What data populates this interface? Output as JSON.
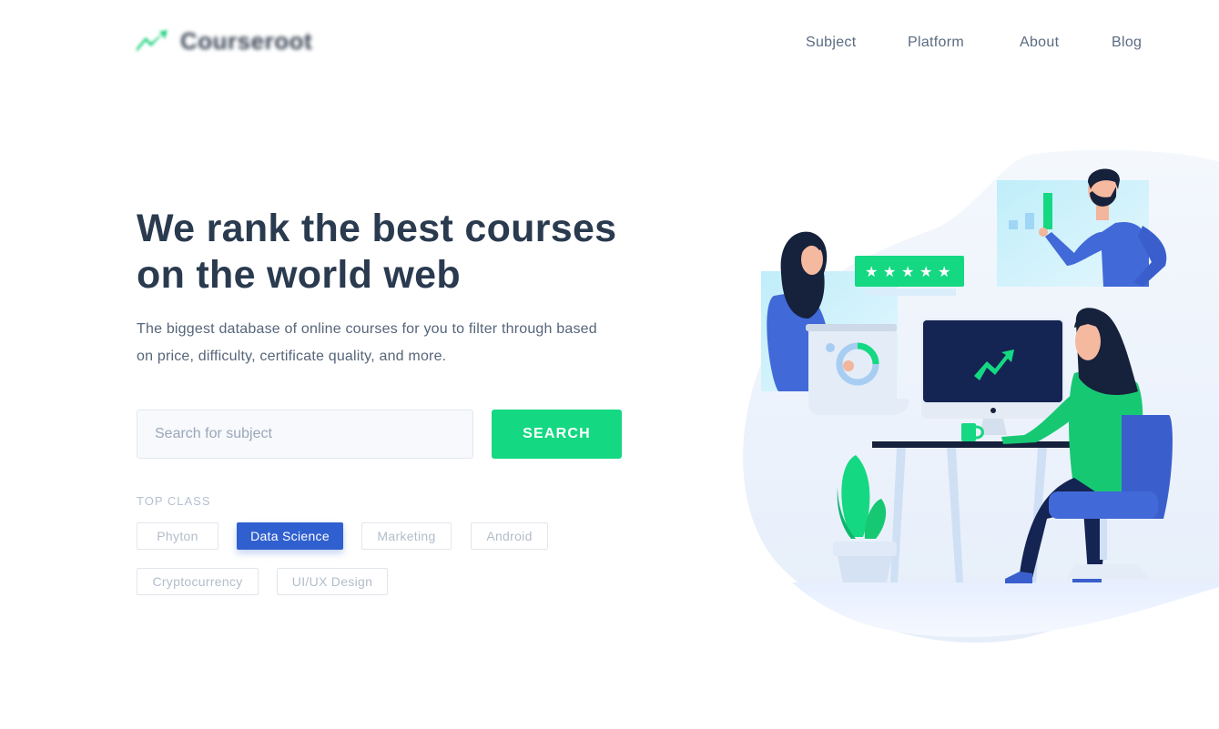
{
  "brand": {
    "name": "Courseroot",
    "accent": "#15d882"
  },
  "nav": {
    "items": [
      {
        "label": "Subject"
      },
      {
        "label": "Platform"
      },
      {
        "label": "About"
      },
      {
        "label": "Blog"
      }
    ]
  },
  "hero": {
    "title_line1": "We rank the best courses",
    "title_line2": "on the world web",
    "subtitle_line1": "The biggest database of online courses for you to filter through based",
    "subtitle_line2": "on price, difficulty, certificate quality, and more."
  },
  "search": {
    "placeholder": "Search for subject",
    "value": "",
    "button_label": "SEARCH"
  },
  "top_class": {
    "label": "TOP CLASS",
    "chips": [
      {
        "label": "Phyton",
        "active": false
      },
      {
        "label": "Data Science",
        "active": true
      },
      {
        "label": "Marketing",
        "active": false
      },
      {
        "label": "Android",
        "active": false
      },
      {
        "label": "Cryptocurrency",
        "active": false
      },
      {
        "label": "UI/UX Design",
        "active": false
      }
    ]
  },
  "colors": {
    "primary_green": "#15d882",
    "active_blue": "#3060cf",
    "heading": "#2a3a4f",
    "body_text": "#56657a"
  }
}
